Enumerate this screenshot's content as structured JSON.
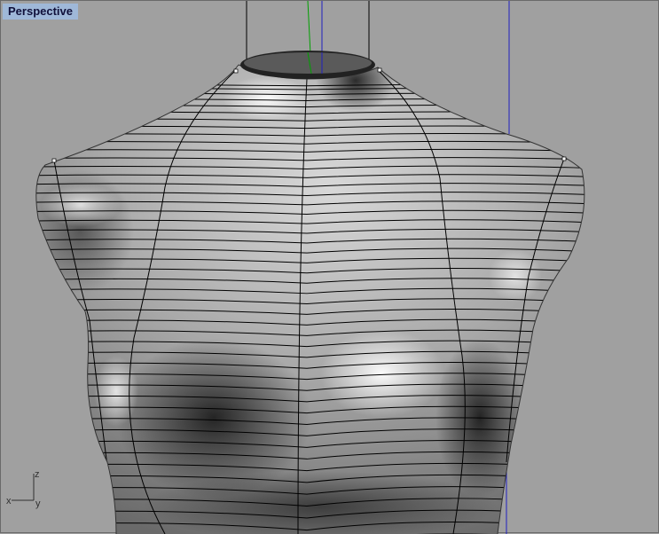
{
  "viewport": {
    "title": "Perspective",
    "axis_labels": {
      "x": "x",
      "y": "y",
      "z": "z"
    }
  },
  "colors": {
    "background": "#a0a0a0",
    "label_bg": "#9fb8d8",
    "axis_green": "#00a000",
    "axis_blue": "#2020c0"
  }
}
